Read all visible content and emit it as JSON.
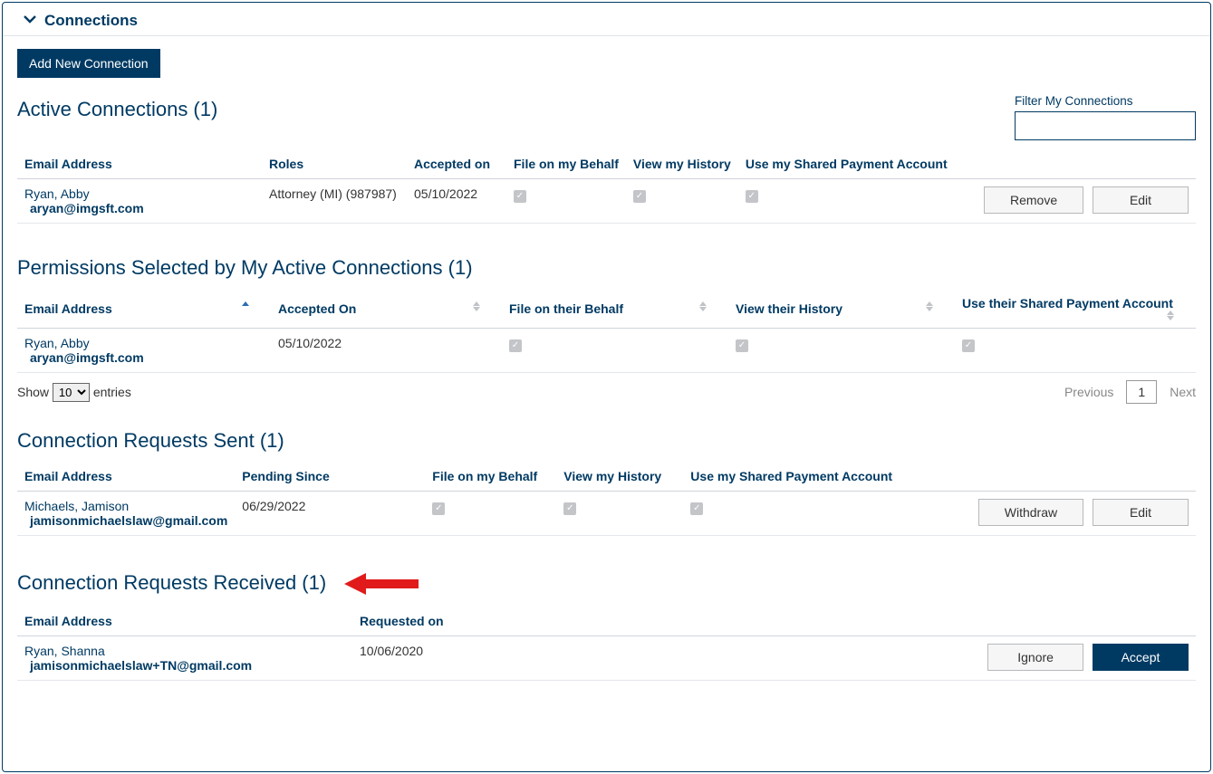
{
  "panel": {
    "title": "Connections"
  },
  "buttons": {
    "add_new": "Add New Connection",
    "remove": "Remove",
    "edit": "Edit",
    "withdraw": "Withdraw",
    "ignore": "Ignore",
    "accept": "Accept"
  },
  "filter": {
    "label": "Filter My Connections",
    "value": ""
  },
  "active": {
    "heading": "Active Connections (1)",
    "cols": {
      "email": "Email Address",
      "roles": "Roles",
      "accepted": "Accepted on",
      "file": "File on my Behalf",
      "history": "View my History",
      "payment": "Use my Shared Payment Account"
    },
    "rows": [
      {
        "name": "Ryan, Abby",
        "email": "aryan@imgsft.com",
        "roles": "Attorney (MI) (987987)",
        "accepted": "05/10/2022",
        "file": true,
        "history": true,
        "payment": true
      }
    ]
  },
  "permissions": {
    "heading": "Permissions Selected by My Active Connections (1)",
    "cols": {
      "email": "Email Address",
      "accepted": "Accepted On",
      "file": "File on their Behalf",
      "history": "View their History",
      "payment": "Use their Shared Payment Account"
    },
    "rows": [
      {
        "name": "Ryan, Abby",
        "email": "aryan@imgsft.com",
        "accepted": "05/10/2022",
        "file": true,
        "history": true,
        "payment": true
      }
    ]
  },
  "pager": {
    "show": "Show",
    "entries": "entries",
    "page_size": "10",
    "previous": "Previous",
    "page": "1",
    "next": "Next"
  },
  "sent": {
    "heading": "Connection Requests Sent (1)",
    "cols": {
      "email": "Email Address",
      "pending": "Pending Since",
      "file": "File on my Behalf",
      "history": "View my History",
      "payment": "Use my Shared Payment Account"
    },
    "rows": [
      {
        "name": "Michaels, Jamison",
        "email": "jamisonmichaelslaw@gmail.com",
        "pending": "06/29/2022",
        "file": true,
        "history": true,
        "payment": true
      }
    ]
  },
  "received": {
    "heading": "Connection Requests Received (1)",
    "cols": {
      "email": "Email Address",
      "requested": "Requested on"
    },
    "rows": [
      {
        "name": "Ryan, Shanna",
        "email": "jamisonmichaelslaw+TN@gmail.com",
        "requested": "10/06/2020"
      }
    ]
  }
}
